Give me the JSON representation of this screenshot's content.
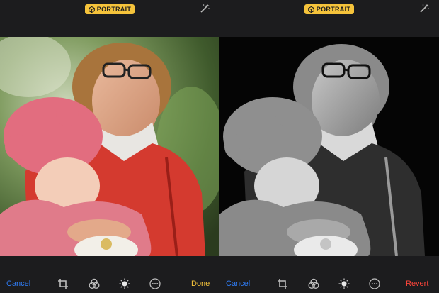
{
  "left_pane": {
    "mode_badge": "PORTRAIT",
    "toolbar": {
      "cancel_label": "Cancel",
      "done_label": "Done"
    },
    "photo": {
      "style": "color"
    }
  },
  "right_pane": {
    "mode_badge": "PORTRAIT",
    "toolbar": {
      "cancel_label": "Cancel",
      "revert_label": "Revert"
    },
    "photo": {
      "style": "black-and-white"
    }
  },
  "icons": {
    "mode": "cube-icon",
    "auto_enhance": "magic-wand-icon",
    "crop": "crop-icon",
    "filters": "filters-icon",
    "adjust": "adjust-dial-icon",
    "more": "more-options-icon"
  },
  "colors": {
    "background": "#1c1c1e",
    "badge": "#f5c33b",
    "cancel": "#2f7cf6",
    "done": "#f5c33b",
    "revert": "#ff453a"
  }
}
